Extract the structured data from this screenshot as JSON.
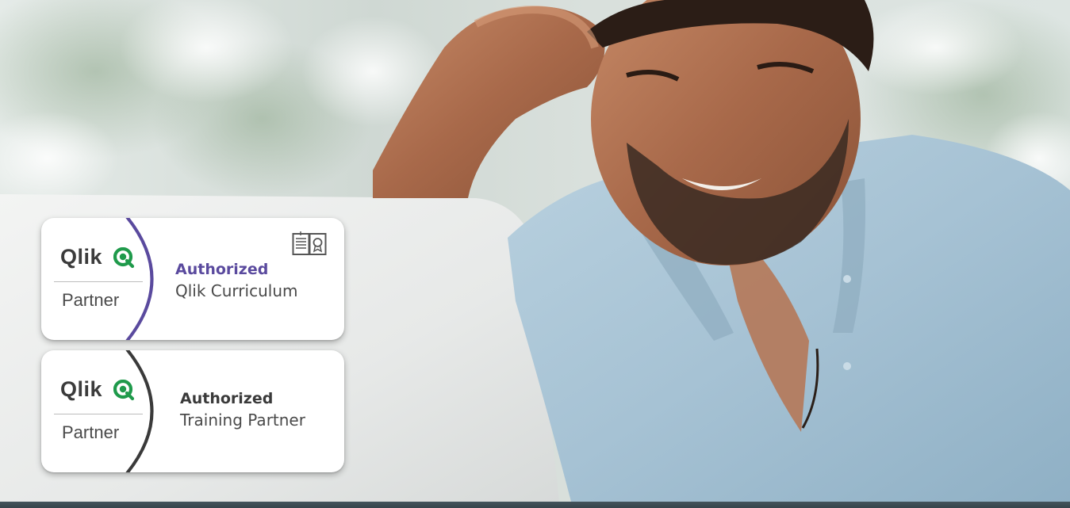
{
  "colors": {
    "purple_accent": "#5a4a9e",
    "dark_accent": "#3a3a3a",
    "text_gray": "#4a4a4a",
    "qlik_green": "#1f9a4b",
    "bottom_bar": "#3f4f57"
  },
  "badges": [
    {
      "logo_text": "Qlik",
      "logo_icon": "qlik-q-icon",
      "partner_label": "Partner",
      "title": "Authorized",
      "subtitle": "Qlik Curriculum",
      "accent": "#5a4a9e",
      "corner_icon": "certificate-book-icon"
    },
    {
      "logo_text": "Qlik",
      "logo_icon": "qlik-q-icon",
      "partner_label": "Partner",
      "title": "Authorized",
      "subtitle": "Training Partner",
      "accent": "#3a3a3a"
    }
  ]
}
